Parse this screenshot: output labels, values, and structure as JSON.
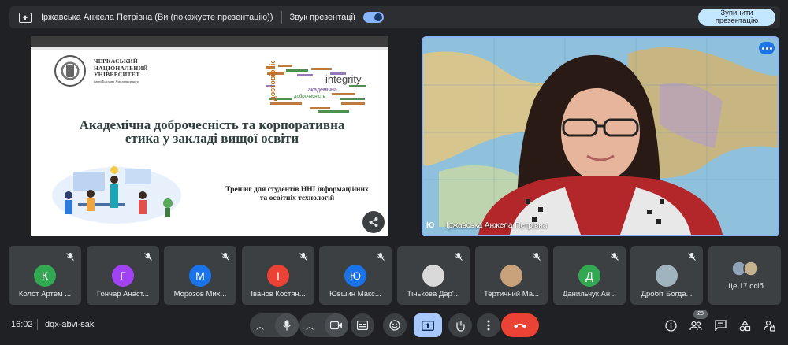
{
  "topbar": {
    "presenting_label": "Іржавська Анжела Петрівна (Ви (покажуєте презентацію))",
    "sound_label": "Звук презентації",
    "stop_button": "Зупинити презентацію"
  },
  "slide": {
    "university_line1": "ЧЕРКАСЬКИЙ",
    "university_line2": "НАЦІОНАЛЬНИЙ",
    "university_line3": "УНІВЕРСИТЕТ",
    "university_sub": "імені Богдана Хмельницького",
    "title": "Академічна доброчесність та корпоративна етика у закладі вищої освіти",
    "subtitle": "Тренінг для студентів ННІ інформаційних та освітніх технологій",
    "wordcloud_integrity": "integrity",
    "wordcloud_academic": "академічна",
    "wordcloud_dobro": "доброчесність",
    "wordcloud_vertical": "достовірність"
  },
  "video": {
    "initial": "Ю",
    "name": "Іржавська Анжела Петрівна"
  },
  "participants": [
    {
      "name": "Колот Артем ...",
      "initial": "К",
      "color": "#33a853"
    },
    {
      "name": "Гончар Анаст...",
      "initial": "Г",
      "color": "#a142f4"
    },
    {
      "name": "Морозов Мих...",
      "initial": "М",
      "color": "#1a73e8"
    },
    {
      "name": "Іванов Костян...",
      "initial": "І",
      "color": "#ea4335"
    },
    {
      "name": "Ювшин Макс...",
      "initial": "Ю",
      "color": "#1a73e8"
    },
    {
      "name": "Тінькова Дар'...",
      "initial": "",
      "color": "#d9d9d9"
    },
    {
      "name": "Тертичний Ма...",
      "initial": "",
      "color": "#c8a27a"
    },
    {
      "name": "Данильчук Ан...",
      "initial": "Д",
      "color": "#33a853"
    },
    {
      "name": "Дробіт Богда...",
      "initial": "",
      "color": "#a0b4c0"
    }
  ],
  "more_participants": "Ще 17 осіб",
  "bottom": {
    "time": "16:02",
    "meeting_code": "dqx-abvi-sak",
    "people_count": "28"
  },
  "colors": {
    "background": "#202124",
    "accent": "#8ab4f8",
    "end_call": "#ea4335"
  }
}
